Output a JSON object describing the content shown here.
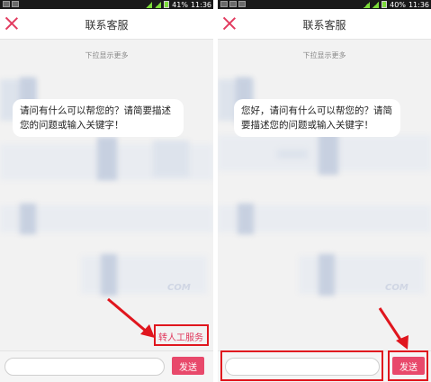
{
  "status": {
    "left": {
      "battery": "41%",
      "time": "11:36"
    },
    "right": {
      "battery": "40%",
      "time": "11:36"
    }
  },
  "header": {
    "title": "联系客服"
  },
  "chat": {
    "pull_hint": "下拉显示更多",
    "greeting_left": "请问有什么可以帮您的？请简要描述您的问题或输入关键字！",
    "greeting_right": "您好，请问有什么可以帮您的？请简要描述您的问题或输入关键字！",
    "watermark_left": "COM",
    "watermark_right": "COM"
  },
  "actions": {
    "transfer_label": "转人工服务",
    "send_label": "发送"
  },
  "input": {
    "value": ""
  },
  "colors": {
    "accent": "#e8496b",
    "highlight_border": "#e0161e"
  },
  "icons": {
    "close": "close-icon",
    "arrow": "red-arrow-annotation"
  }
}
